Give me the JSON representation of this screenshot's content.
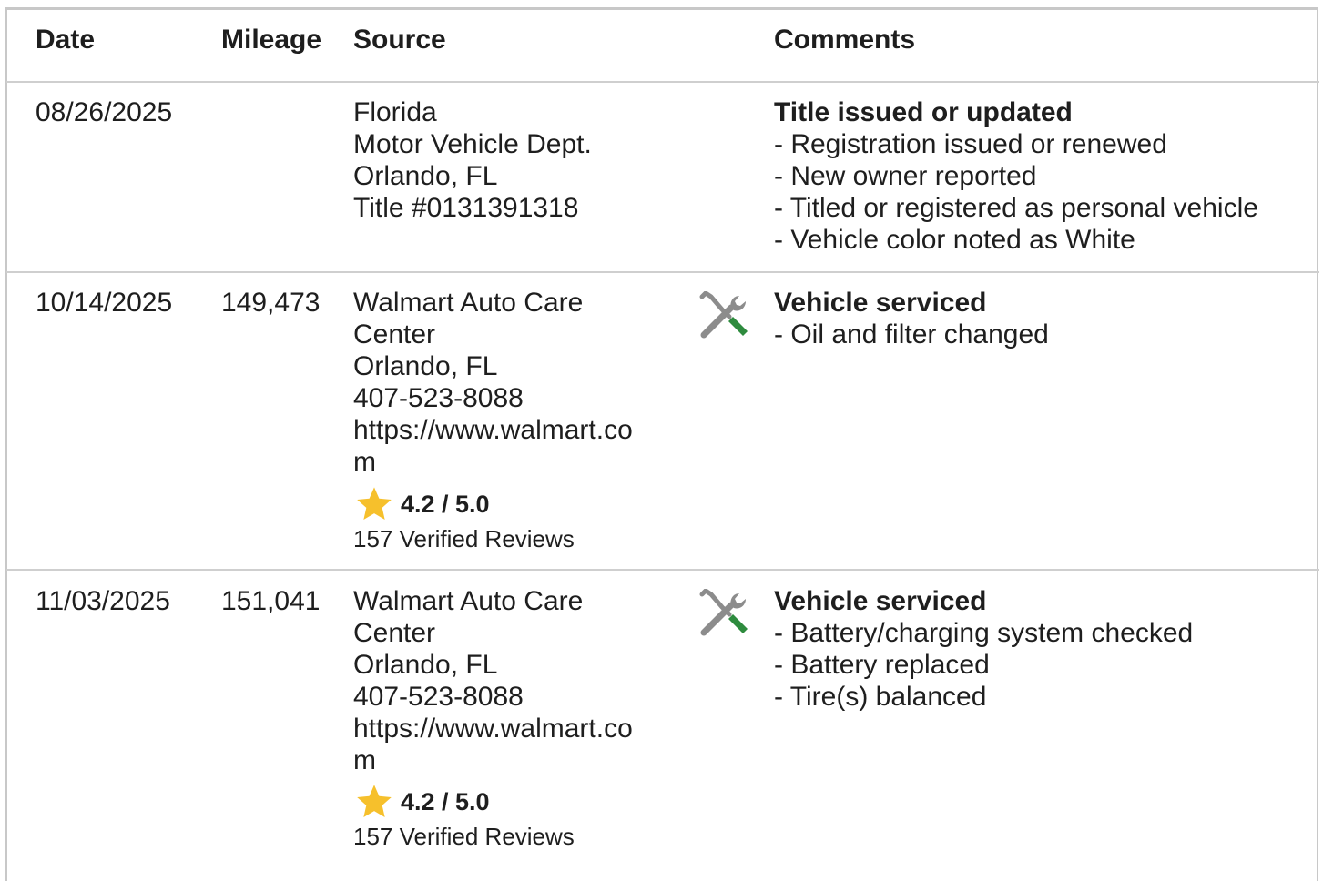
{
  "header": {
    "date": "Date",
    "mileage": "Mileage",
    "source": "Source",
    "comments": "Comments"
  },
  "rows": [
    {
      "date": "08/26/2025",
      "mileage": "",
      "source": [
        "Florida",
        "Motor Vehicle Dept.",
        "Orlando, FL",
        "Title #0131391318"
      ],
      "icon": "",
      "title": "Title issued or updated",
      "bullets": [
        "- Registration issued or renewed",
        "- New owner reported",
        "- Titled or registered as personal vehicle",
        "- Vehicle color noted as White"
      ]
    },
    {
      "date": "10/14/2025",
      "mileage": "149,473",
      "source": [
        "Walmart Auto Care",
        "Center",
        "Orlando, FL",
        "407-523-8088",
        "https://www.walmart.co",
        "m"
      ],
      "rating": "4.2 / 5.0",
      "reviews": "157 Verified Reviews",
      "icon": "wrench-screwdriver-icon",
      "title": "Vehicle serviced",
      "bullets": [
        "- Oil and filter changed"
      ]
    },
    {
      "date": "11/03/2025",
      "mileage": "151,041",
      "source": [
        "Walmart Auto Care",
        "Center",
        "Orlando, FL",
        "407-523-8088",
        "https://www.walmart.co",
        "m"
      ],
      "rating": "4.2 / 5.0",
      "reviews": "157 Verified Reviews",
      "icon": "wrench-screwdriver-icon",
      "title": "Vehicle serviced",
      "bullets": [
        "- Battery/charging system checked",
        "- Battery replaced",
        "- Tire(s) balanced"
      ]
    }
  ],
  "colors": {
    "star": "#f6c02c",
    "tool_gray": "#8c8c8c",
    "tool_green": "#2e8b3e",
    "divider": "#cfcfcf"
  }
}
